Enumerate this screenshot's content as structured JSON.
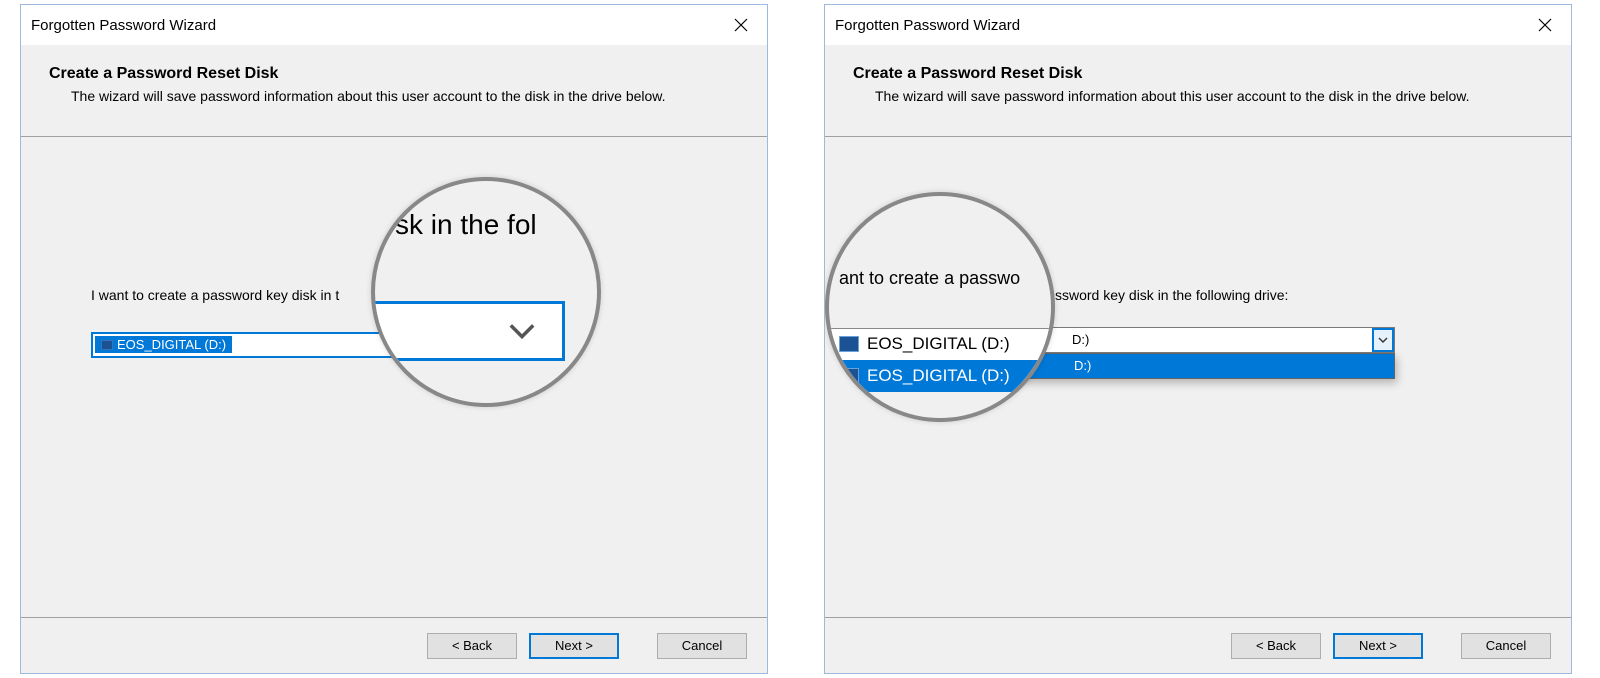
{
  "left": {
    "title": "Forgotten Password Wizard",
    "heading": "Create a Password Reset Disk",
    "subtext": "The wizard will save password information about this user account to the disk in the drive below.",
    "prompt": "I want to create a password key disk in t",
    "selected_drive": "EOS_DIGITAL (D:)",
    "magnifier_text": "sk in the fol",
    "buttons": {
      "back": "< Back",
      "next": "Next >",
      "cancel": "Cancel"
    }
  },
  "right": {
    "title": "Forgotten Password Wizard",
    "heading": "Create a Password Reset Disk",
    "subtext": "The wizard will save password information about this user account to the disk in the drive below.",
    "prompt_tail": "ssword key disk in the following drive:",
    "dropdown_value": "D:)",
    "dropdown_options": [
      "D:)"
    ],
    "magnifier_text": "ant to create a passwo",
    "mag_option_a": "EOS_DIGITAL (D:)",
    "mag_option_b": "EOS_DIGITAL (D:)",
    "buttons": {
      "back": "< Back",
      "next": "Next >",
      "cancel": "Cancel"
    }
  }
}
